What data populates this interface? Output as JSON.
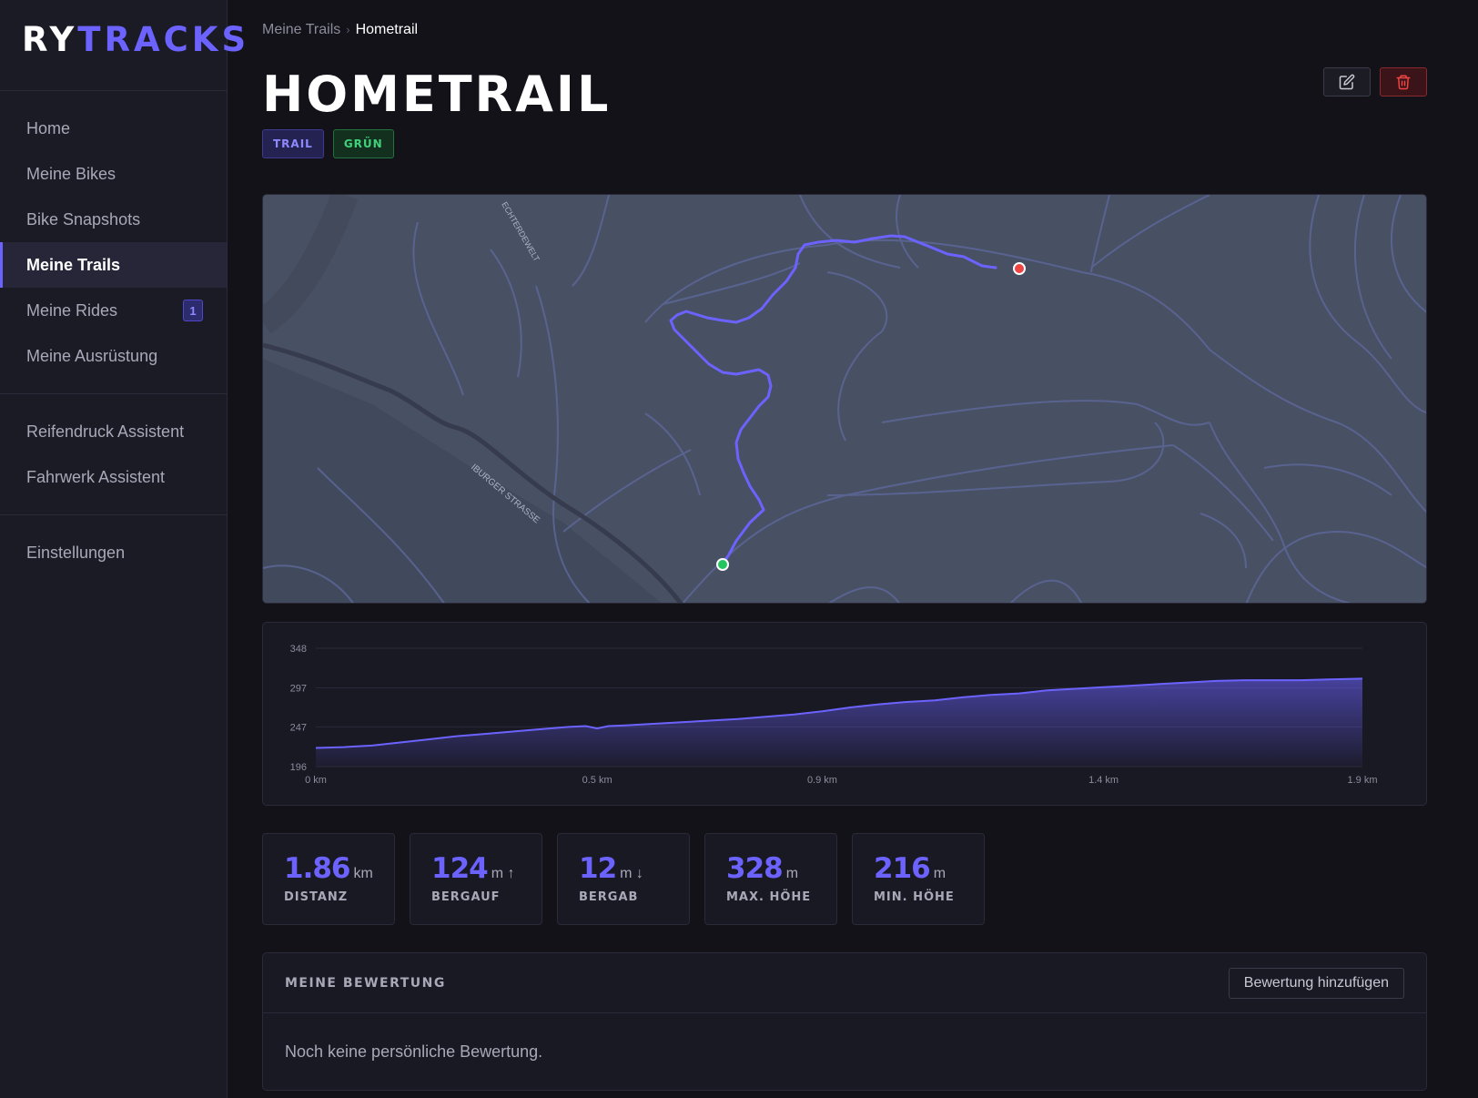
{
  "brand": {
    "part1": "RY",
    "part2": "TRACKS"
  },
  "sidebar": {
    "groups": [
      [
        {
          "label": "Home",
          "active": false
        },
        {
          "label": "Meine Bikes",
          "active": false
        },
        {
          "label": "Bike Snapshots",
          "active": false
        },
        {
          "label": "Meine Trails",
          "active": true
        },
        {
          "label": "Meine Rides",
          "active": false,
          "badge": "1"
        },
        {
          "label": "Meine Ausrüstung",
          "active": false
        }
      ],
      [
        {
          "label": "Reifendruck Assistent",
          "active": false
        },
        {
          "label": "Fahrwerk Assistent",
          "active": false
        }
      ],
      [
        {
          "label": "Einstellungen",
          "active": false
        }
      ]
    ]
  },
  "breadcrumb": {
    "parent": "Meine Trails",
    "separator": "›",
    "current": "Hometrail"
  },
  "page": {
    "title": "HOMETRAIL",
    "tags": [
      {
        "label": "TRAIL",
        "kind": "trail"
      },
      {
        "label": "GRÜN",
        "kind": "gruen"
      }
    ],
    "actions": {
      "edit_icon": "edit-icon",
      "delete_icon": "trash-icon"
    }
  },
  "map": {
    "street_labels": [
      "IBURGER STRASSE",
      "ECHTERDEWELT"
    ],
    "colors": {
      "track": "#6c63ff",
      "start": "#22c55e",
      "end": "#ef4444"
    }
  },
  "chart_data": {
    "type": "area",
    "title": "",
    "xlabel": "",
    "ylabel": "",
    "x_tick_labels": [
      "0 km",
      "0.5 km",
      "0.9 km",
      "1.4 km",
      "1.9 km"
    ],
    "y_tick_labels": [
      "348",
      "297",
      "247",
      "196"
    ],
    "xlim": [
      0,
      1.86
    ],
    "ylim": [
      196,
      348
    ],
    "x": [
      0,
      0.05,
      0.1,
      0.15,
      0.2,
      0.25,
      0.3,
      0.35,
      0.4,
      0.45,
      0.48,
      0.5,
      0.52,
      0.55,
      0.6,
      0.65,
      0.7,
      0.75,
      0.8,
      0.85,
      0.9,
      0.95,
      1.0,
      1.05,
      1.1,
      1.15,
      1.2,
      1.25,
      1.3,
      1.35,
      1.4,
      1.45,
      1.5,
      1.55,
      1.6,
      1.65,
      1.7,
      1.75,
      1.8,
      1.86
    ],
    "series": [
      {
        "values": [
          220,
          221,
          223,
          227,
          231,
          235,
          238,
          241,
          244,
          247,
          248,
          245,
          248,
          249,
          251,
          253,
          255,
          257,
          260,
          263,
          267,
          272,
          276,
          279,
          281,
          285,
          288,
          290,
          294,
          296,
          298,
          300,
          302,
          304,
          306,
          307,
          307,
          307,
          308,
          309
        ],
        "color": "#6c63ff"
      }
    ]
  },
  "stats": [
    {
      "value": "1.86",
      "unit": "km",
      "label": "DISTANZ"
    },
    {
      "value": "124",
      "unit": "m ↑",
      "label": "BERGAUF"
    },
    {
      "value": "12",
      "unit": "m ↓",
      "label": "BERGAB"
    },
    {
      "value": "328",
      "unit": "m",
      "label": "MAX. HÖHE"
    },
    {
      "value": "216",
      "unit": "m",
      "label": "MIN. HÖHE"
    }
  ],
  "rating": {
    "title": "MEINE BEWERTUNG",
    "button": "Bewertung hinzufügen",
    "empty_text": "Noch keine persönliche Bewertung."
  }
}
